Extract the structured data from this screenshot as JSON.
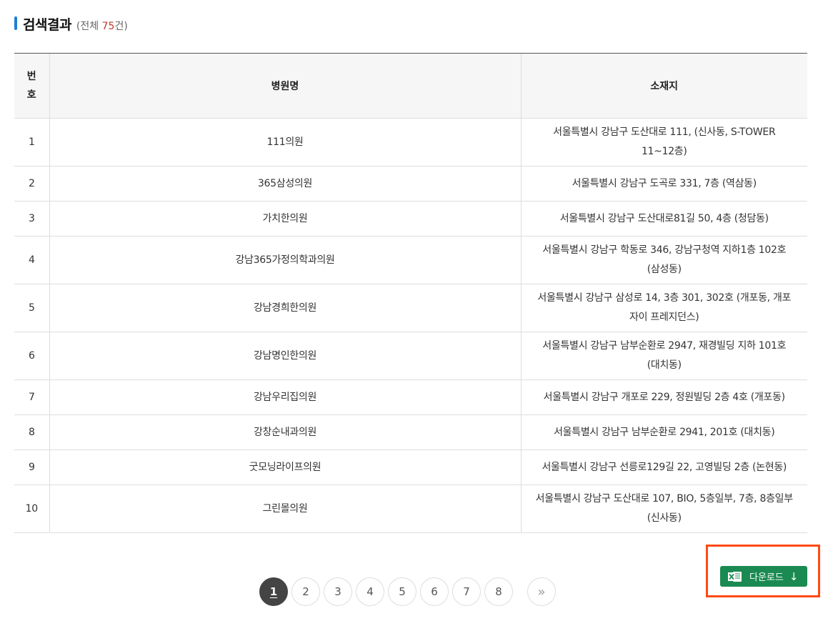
{
  "header": {
    "title": "검색결과",
    "count_prefix": "(전체 ",
    "count_value": "75",
    "count_suffix": "건)"
  },
  "table": {
    "columns": {
      "no": "번호",
      "name": "병원명",
      "address": "소재지"
    },
    "rows": [
      {
        "no": "1",
        "name": "111의원",
        "address": "서울특별시 강남구 도산대로 111, (신사동, S-TOWER 11~12층)"
      },
      {
        "no": "2",
        "name": "365삼성의원",
        "address": "서울특별시 강남구 도곡로 331, 7층 (역삼동)"
      },
      {
        "no": "3",
        "name": "가치한의원",
        "address": "서울특별시 강남구 도산대로81길 50, 4층 (청담동)"
      },
      {
        "no": "4",
        "name": "강남365가정의학과의원",
        "address": "서울특별시 강남구 학동로 346, 강남구청역 지하1층 102호 (삼성동)"
      },
      {
        "no": "5",
        "name": "강남경희한의원",
        "address": "서울특별시 강남구 삼성로 14, 3층 301, 302호 (개포동, 개포자이 프레지던스)"
      },
      {
        "no": "6",
        "name": "강남명인한의원",
        "address": "서울특별시 강남구 남부순환로 2947, 재경빌딩 지하 101호 (대치동)"
      },
      {
        "no": "7",
        "name": "강남우리집의원",
        "address": "서울특별시 강남구 개포로 229, 정원빌딩 2층 4호 (개포동)"
      },
      {
        "no": "8",
        "name": "강창순내과의원",
        "address": "서울특별시 강남구 남부순환로 2941, 201호 (대치동)"
      },
      {
        "no": "9",
        "name": "굿모닝라이프의원",
        "address": "서울특별시 강남구 선릉로129길 22, 고영빌딩 2층 (논현동)"
      },
      {
        "no": "10",
        "name": "그린몰의원",
        "address": "서울특별시 강남구 도산대로 107, BIO, 5층일부, 7층, 8층일부 (신사동)"
      }
    ]
  },
  "pagination": {
    "pages": [
      "1",
      "2",
      "3",
      "4",
      "5",
      "6",
      "7",
      "8"
    ],
    "current": "1",
    "next_label": "»"
  },
  "download": {
    "label": "다운로드",
    "icon": "excel-icon",
    "arrow": "↓",
    "highlight_color": "#ff4a14",
    "button_color": "#1a8a52"
  }
}
